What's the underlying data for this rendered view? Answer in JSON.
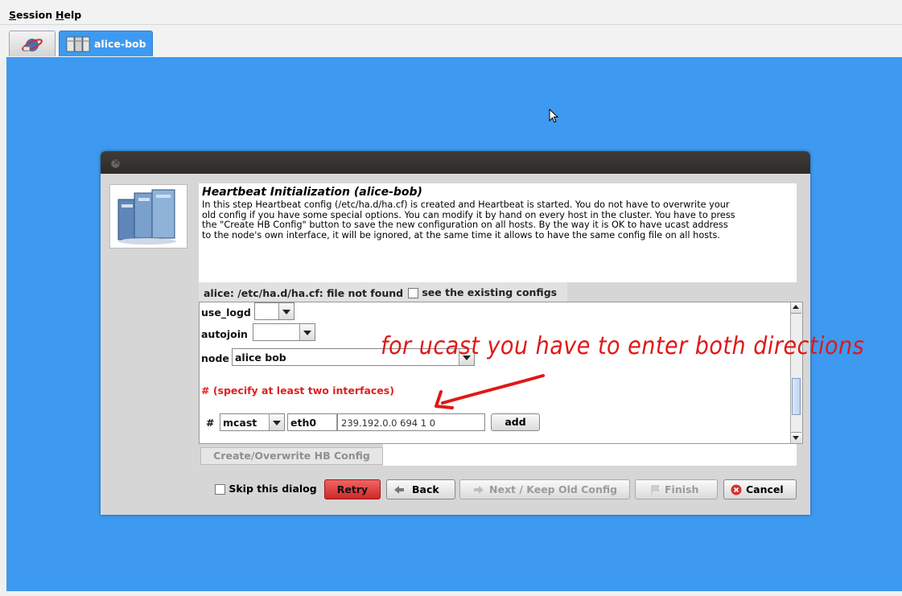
{
  "menubar": {
    "session_u": "S",
    "session_rest": "ession",
    "help_u": "H",
    "help_rest": "elp"
  },
  "tabs": {
    "cluster_label": "alice-bob"
  },
  "dialog": {
    "title": "Heartbeat Initialization (alice-bob)",
    "description_lines": [
      "In this step Heartbeat config (/etc/ha.d/ha.cf) is created and Heartbeat is started. You do not have to overwrite your",
      "old config if you have some special options. You can modify it by hand on every host in the cluster. You have to press",
      "the \"Create HB Config\" button to save the new configuration on all hosts. By the way it is OK to have ucast address",
      "to the node's own interface, it will be ignored, at the same time it allows to have the same config file on all hosts."
    ],
    "status_text": "alice: /etc/ha.d/ha.cf: file not found",
    "see_configs_label": "see the existing configs",
    "fields": {
      "use_logd_label": "use_logd",
      "use_logd_value": "",
      "autojoin_label": "autojoin",
      "autojoin_value": "",
      "node_label": "node",
      "node_value": "alice bob",
      "interfaces_hint": "# (specify at least two interfaces)",
      "hash_label": "#",
      "type_value": "mcast",
      "iface_value": "eth0",
      "address_value": "239.192.0.0 694 1 0",
      "add_label": "add"
    },
    "create_button": "Create/Overwrite HB Config",
    "skip_label": "Skip this dialog",
    "buttons": {
      "retry": "Retry",
      "back": "Back",
      "next": "Next / Keep Old Config",
      "finish": "Finish",
      "cancel": "Cancel"
    }
  },
  "annotation": {
    "text": "for ucast you have to enter both directions"
  },
  "colors": {
    "desktop": "#3d9af0",
    "accent_red": "#e01818",
    "titlebar": "#3a3633"
  }
}
